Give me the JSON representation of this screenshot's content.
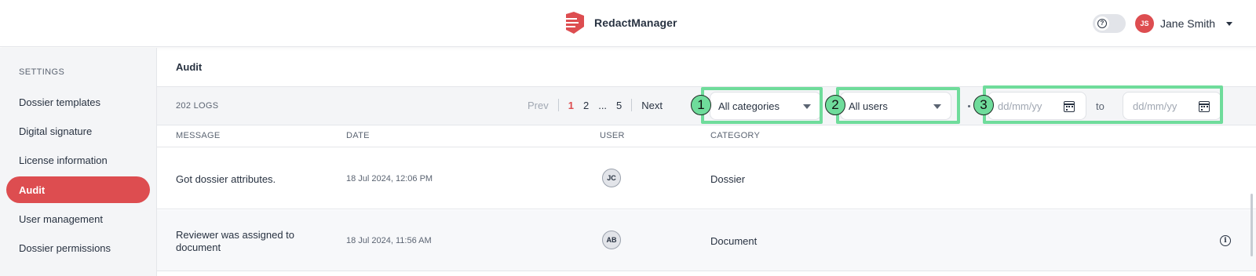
{
  "header": {
    "app_name": "RedactManager",
    "help_icon": "question-circle-icon",
    "user": {
      "initials": "JS",
      "name": "Jane Smith"
    },
    "colors": {
      "brand": "#dd4d50"
    }
  },
  "sidebar": {
    "section_title": "SETTINGS",
    "items": [
      {
        "label": "Dossier templates",
        "active": false
      },
      {
        "label": "Digital signature",
        "active": false
      },
      {
        "label": "License information",
        "active": false
      },
      {
        "label": "Audit",
        "active": true
      },
      {
        "label": "User management",
        "active": false
      },
      {
        "label": "Dossier permissions",
        "active": false
      }
    ]
  },
  "main": {
    "title": "Audit",
    "logs_count": "202 LOGS",
    "pagination": {
      "prev": "Prev",
      "pages": [
        "1",
        "2",
        "...",
        "5"
      ],
      "current": "1",
      "next": "Next"
    },
    "filters": {
      "category": "All categories",
      "user": "All users",
      "date_from_placeholder": "dd/mm/yy",
      "to_label": "to",
      "date_to_placeholder": "dd/mm/yy"
    },
    "annotations": [
      "1",
      "2",
      "3"
    ],
    "columns": [
      "MESSAGE",
      "DATE",
      "USER",
      "CATEGORY"
    ],
    "rows": [
      {
        "message": "Got dossier attributes.",
        "date": "18 Jul 2024, 12:06 PM",
        "user": "JC",
        "category": "Dossier"
      },
      {
        "message": "Reviewer was assigned to document",
        "date": "18 Jul 2024, 11:56 AM",
        "user": "AB",
        "category": "Document",
        "info_icon": "info-circle-icon"
      }
    ]
  }
}
